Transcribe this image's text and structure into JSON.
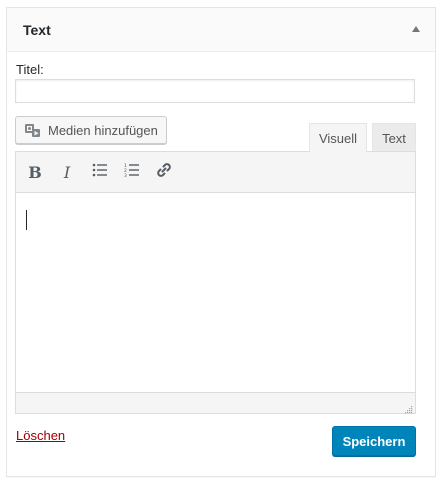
{
  "widget": {
    "title": "Text",
    "collapse_icon": "triangle-up-icon"
  },
  "form": {
    "title_label": "Titel:",
    "title_value": "",
    "title_placeholder": ""
  },
  "editor": {
    "media_button_label": "Medien hinzufügen",
    "media_icon": "add-media-icon",
    "tabs": [
      {
        "label": "Visuell",
        "active": true
      },
      {
        "label": "Text",
        "active": false
      }
    ],
    "toolbar": [
      {
        "name": "bold",
        "glyph": "B"
      },
      {
        "name": "italic",
        "glyph": "I"
      },
      {
        "name": "bulleted-list",
        "icon": "bulleted-list-icon"
      },
      {
        "name": "numbered-list",
        "icon": "numbered-list-icon"
      },
      {
        "name": "link",
        "icon": "link-icon"
      }
    ],
    "content": ""
  },
  "actions": {
    "delete_label": "Löschen",
    "save_label": "Speichern"
  },
  "colors": {
    "primary": "#0085ba",
    "delete": "#a00000",
    "text": "#23282d"
  }
}
